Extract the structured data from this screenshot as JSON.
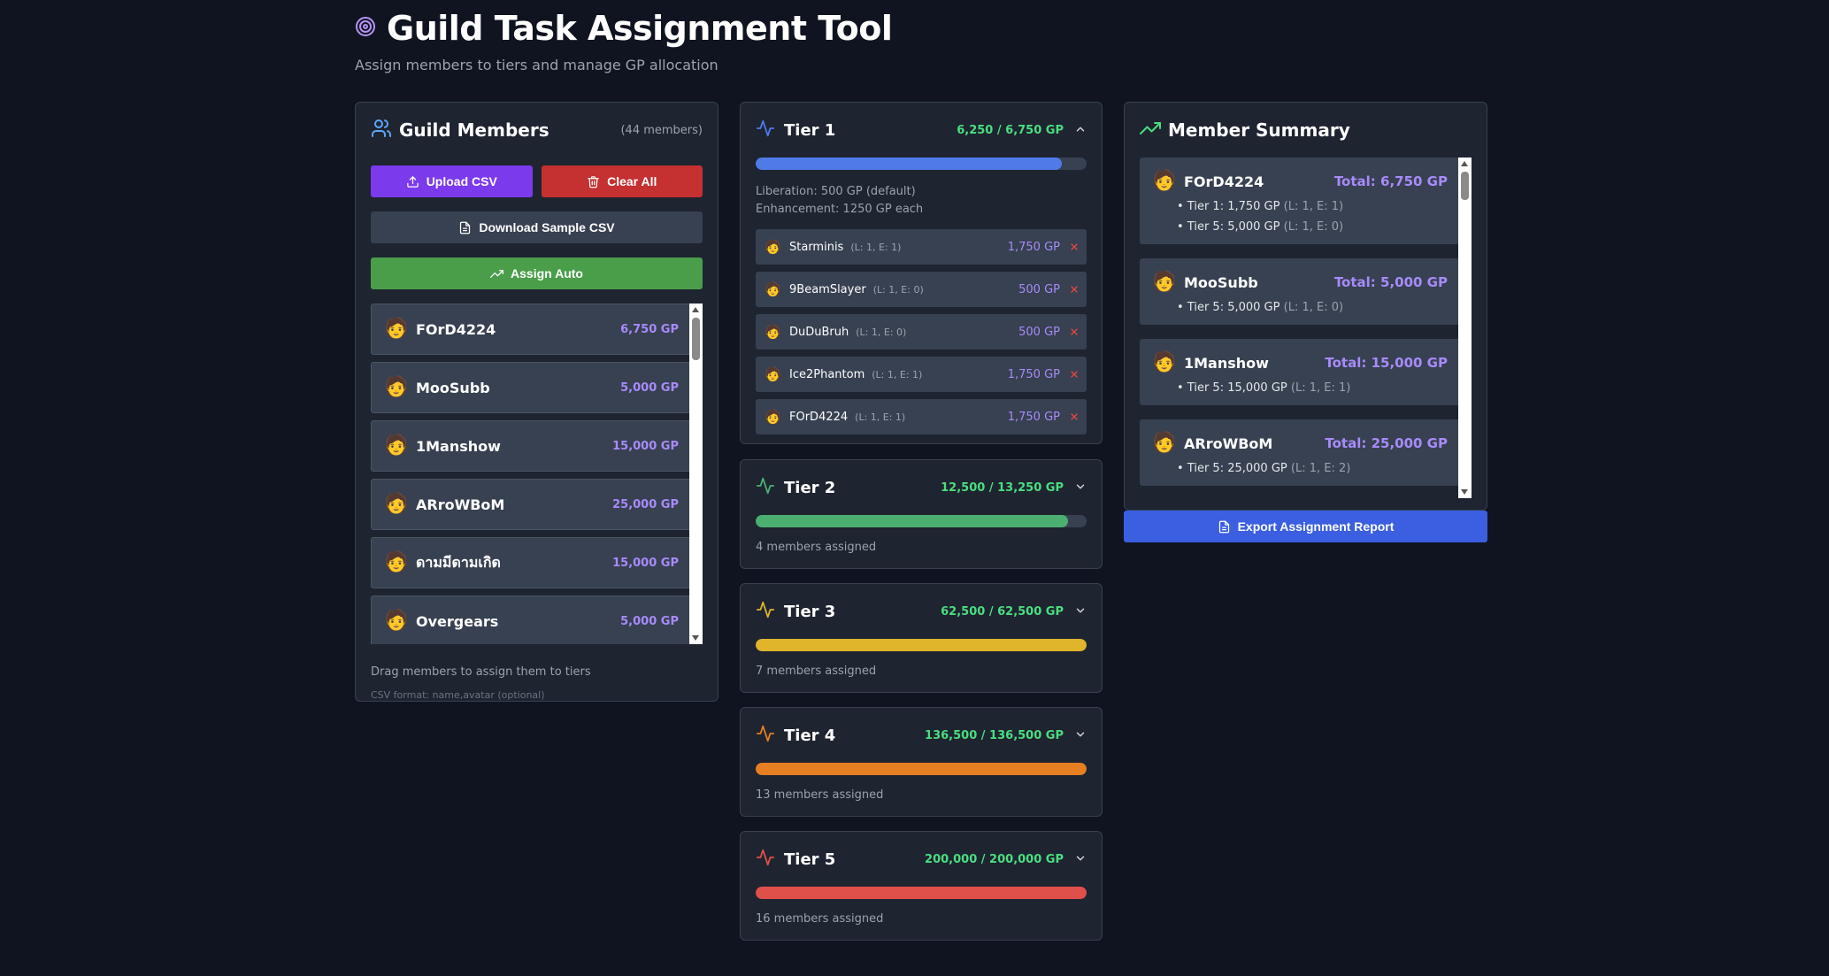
{
  "header": {
    "title": "Guild Task Assignment Tool",
    "subtitle": "Assign members to tiers and manage GP allocation"
  },
  "members_panel": {
    "title": "Guild Members",
    "count": "(44 members)",
    "upload_label": "Upload CSV",
    "clear_label": "Clear All",
    "sample_label": "Download Sample CSV",
    "auto_label": "Assign Auto",
    "drag_hint": "Drag members to assign them to tiers",
    "csv_format": "CSV format: name,avatar (optional)",
    "members": [
      {
        "name": "FOrD4224",
        "gp": "6,750 GP",
        "avatar": "🧑"
      },
      {
        "name": "MooSubb",
        "gp": "5,000 GP",
        "avatar": "🧑"
      },
      {
        "name": "1Manshow",
        "gp": "15,000 GP",
        "avatar": "🧑"
      },
      {
        "name": "ARroWBoM",
        "gp": "25,000 GP",
        "avatar": "🧑"
      },
      {
        "name": "ดามมีดามเกิด",
        "gp": "15,000 GP",
        "avatar": "🧑"
      },
      {
        "name": "Overgears",
        "gp": "5,000 GP",
        "avatar": "🧑"
      }
    ]
  },
  "tiers": [
    {
      "title": "Tier 1",
      "gp": "6,250 / 6,750 GP",
      "color": "#4f7ae8",
      "progress": 0.926,
      "expanded": true,
      "note1": "Liberation: 500 GP (default)",
      "note2": "Enhancement: 1250 GP each",
      "assigned": [
        {
          "name": "Starminis",
          "le": "(L: 1, E: 1)",
          "gp": "1,750 GP"
        },
        {
          "name": "9BeamSlayer",
          "le": "(L: 1, E: 0)",
          "gp": "500 GP"
        },
        {
          "name": "DuDuBruh",
          "le": "(L: 1, E: 0)",
          "gp": "500 GP"
        },
        {
          "name": "Ice2Phantom",
          "le": "(L: 1, E: 1)",
          "gp": "1,750 GP"
        },
        {
          "name": "FOrD4224",
          "le": "(L: 1, E: 1)",
          "gp": "1,750 GP"
        }
      ]
    },
    {
      "title": "Tier 2",
      "gp": "12,500 / 13,250 GP",
      "color": "#4caf72",
      "progress": 0.943,
      "count": "4 members assigned"
    },
    {
      "title": "Tier 3",
      "gp": "62,500 / 62,500 GP",
      "color": "#e0b42b",
      "progress": 1.0,
      "count": "7 members assigned"
    },
    {
      "title": "Tier 4",
      "gp": "136,500 / 136,500 GP",
      "color": "#e67e22",
      "progress": 1.0,
      "count": "13 members assigned"
    },
    {
      "title": "Tier 5",
      "gp": "200,000 / 200,000 GP",
      "color": "#e0504a",
      "progress": 1.0,
      "count": "16 members assigned"
    }
  ],
  "summary_panel": {
    "title": "Member Summary",
    "export_label": "Export Assignment Report",
    "cards": [
      {
        "name": "FOrD4224",
        "total": "Total: 6,750 GP",
        "lines": [
          {
            "text": "• Tier 1: 1,750 GP",
            "le": "(L: 1, E: 1)"
          },
          {
            "text": "• Tier 5: 5,000 GP",
            "le": "(L: 1, E: 0)"
          }
        ]
      },
      {
        "name": "MooSubb",
        "total": "Total: 5,000 GP",
        "lines": [
          {
            "text": "• Tier 5: 5,000 GP",
            "le": "(L: 1, E: 0)"
          }
        ]
      },
      {
        "name": "1Manshow",
        "total": "Total: 15,000 GP",
        "lines": [
          {
            "text": "• Tier 5: 15,000 GP",
            "le": "(L: 1, E: 1)"
          }
        ]
      },
      {
        "name": "ARroWBoM",
        "total": "Total: 25,000 GP",
        "lines": [
          {
            "text": "• Tier 5: 25,000 GP",
            "le": "(L: 1, E: 2)"
          }
        ]
      }
    ]
  },
  "colors": {
    "accent_purple": "#7c3aed",
    "danger": "#c53030",
    "success": "#4a9e4a",
    "export_blue": "#3b5fe0",
    "gp_purple": "#a78bfa",
    "gp_green": "#4ade80"
  }
}
